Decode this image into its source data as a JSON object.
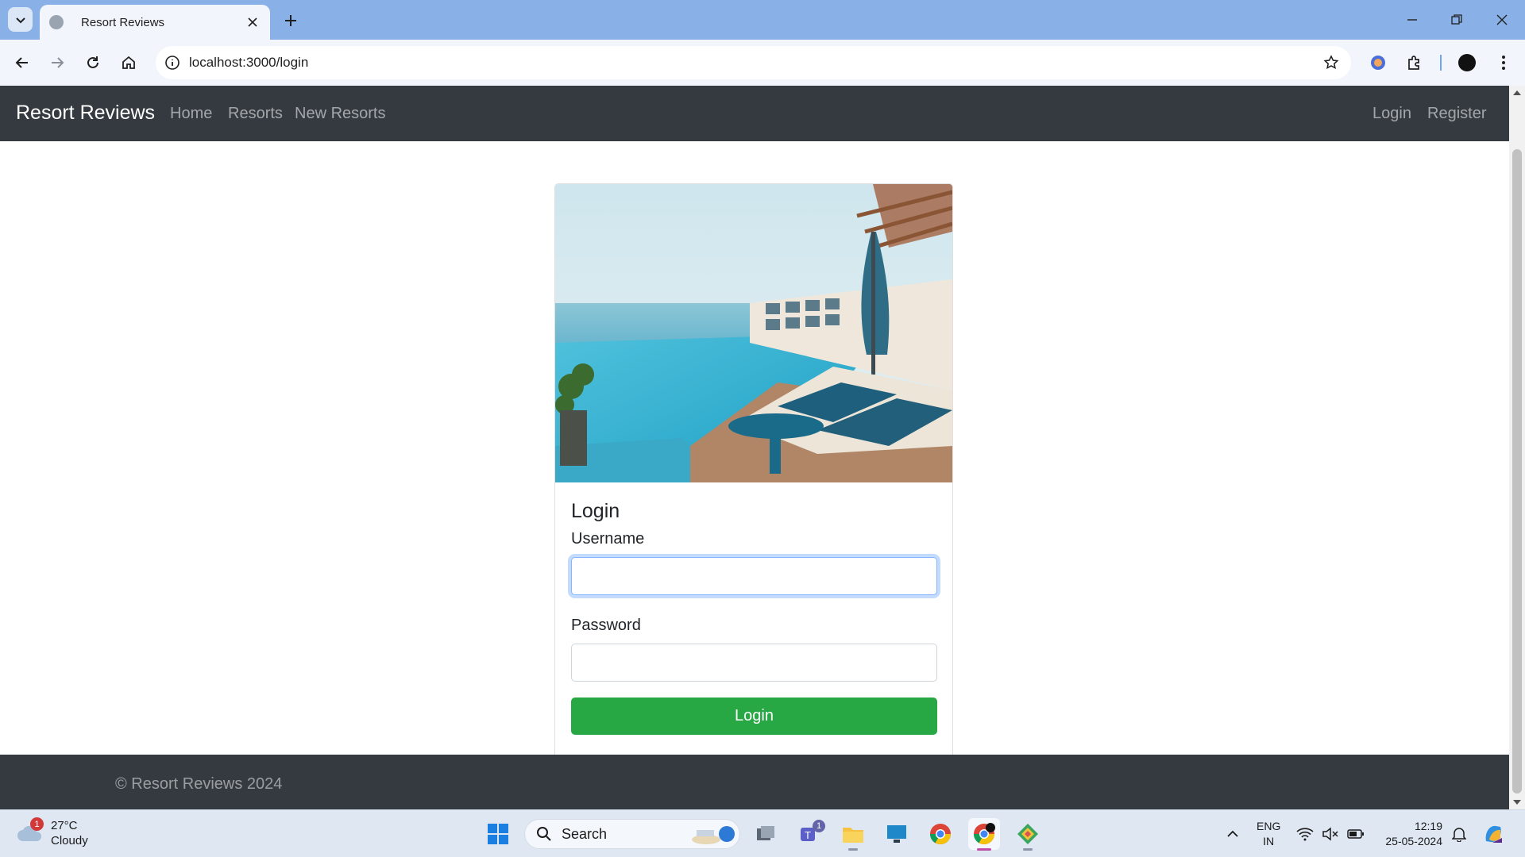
{
  "browser": {
    "tab_title": "Resort Reviews",
    "url": "localhost:3000/login"
  },
  "navbar": {
    "brand": "Resort Reviews",
    "links": [
      "Home",
      "Resorts",
      "New Resorts"
    ],
    "right_links": [
      "Login",
      "Register"
    ]
  },
  "login_card": {
    "title": "Login",
    "username_label": "Username",
    "username_value": "",
    "password_label": "Password",
    "password_value": "",
    "submit_label": "Login"
  },
  "footer": {
    "text": "© Resort Reviews 2024"
  },
  "taskbar": {
    "weather_temp": "27°C",
    "weather_condition": "Cloudy",
    "weather_badge": "1",
    "search_label": "Search",
    "teams_badge": "1",
    "lang_line1": "ENG",
    "lang_line2": "IN",
    "time": "12:19",
    "date": "25-05-2024"
  },
  "colors": {
    "navbar_bg": "#343a40",
    "login_button": "#28a745",
    "tabbar_bg": "#8ab0e8"
  }
}
